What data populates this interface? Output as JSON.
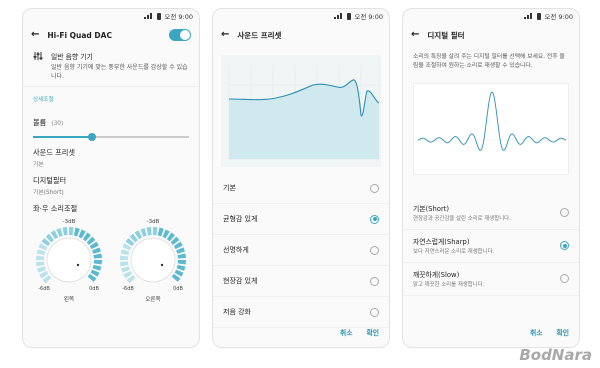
{
  "status": {
    "time": "오전 9:00"
  },
  "screen1": {
    "title": "Hi-Fi Quad DAC",
    "header_title": "일반 음향 기기",
    "header_desc": "일반 음향 기기에 맞는 풍부한 사운드를 감상할 수 있습니다.",
    "section_label": "상세조절",
    "volume_label": "볼륨",
    "volume_value": "(30)",
    "volume_level": 0.38,
    "preset_label": "사운드 프리셋",
    "preset_value": "기본",
    "filter_label": "디지털필터",
    "filter_value": "기본(Short)",
    "balance_label": "좌·우 소리조절",
    "left_knob": {
      "top": "-3dB",
      "min": "-6dB",
      "max": "0dB",
      "name": "왼쪽"
    },
    "right_knob": {
      "top": "-3dB",
      "min": "-6dB",
      "max": "0dB",
      "name": "오른쪽"
    }
  },
  "screen2": {
    "title": "사운드 프리셋",
    "options": [
      {
        "label": "기본",
        "selected": false
      },
      {
        "label": "균형감 있게",
        "selected": true
      },
      {
        "label": "선명하게",
        "selected": false
      },
      {
        "label": "현장감 있게",
        "selected": false
      },
      {
        "label": "저음 강화",
        "selected": false
      }
    ],
    "cancel": "취소",
    "ok": "확인"
  },
  "screen3": {
    "title": "디지털 필터",
    "desc": "소리의 특징을 살려 주는 디지털 필터를 선택해 보세요. 전후 울림을 조절하여 원하는 소리로 재생할 수 있습니다.",
    "options": [
      {
        "label": "기본(Short)",
        "desc": "현장감과 공간감을 살린 소리로 재생합니다.",
        "selected": false
      },
      {
        "label": "자연스럽게(Sharp)",
        "desc": "보다 자연스러운 소리로 재생합니다.",
        "selected": true
      },
      {
        "label": "깨끗하게(Slow)",
        "desc": "맑고 깨끗한 소리를 재생합니다.",
        "selected": false
      }
    ],
    "cancel": "취소",
    "ok": "확인"
  },
  "watermark": "BodNara",
  "colors": {
    "accent": "#3aa6c0",
    "chart_fill": "#cfe9ef"
  }
}
